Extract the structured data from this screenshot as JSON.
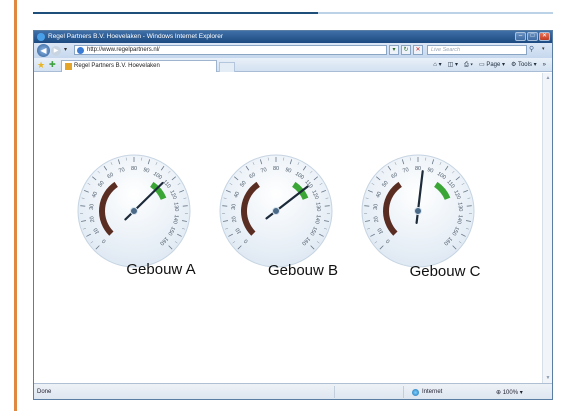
{
  "window": {
    "title": "Regel Partners B.V. Hoevelaken - Windows Internet Explorer",
    "minimize_glyph": "–",
    "maximize_glyph": "□",
    "close_glyph": "✕"
  },
  "address": {
    "url": "http://www.regelpartners.nl/",
    "search_placeholder": "Live Search"
  },
  "tab": {
    "label": "Regel Partners B.V. Hoevelaken"
  },
  "toolbar": {
    "page_label": "Page",
    "tools_label": "Tools"
  },
  "status": {
    "left": "Done",
    "zone": "Internet",
    "zoom": "100%"
  },
  "colors": {
    "arc_brown": "#5a2d22",
    "arc_green": "#3aa635",
    "needle": "#1c2a3a",
    "face": "#dfe9f3"
  },
  "gauges": [
    {
      "label": "Gebouw A",
      "scale": [
        0,
        10,
        20,
        30,
        40,
        50,
        60,
        70,
        80,
        90,
        100,
        110,
        120,
        130,
        140,
        150,
        160
      ],
      "value": 107
    },
    {
      "label": "Gebouw B",
      "scale": [
        0,
        10,
        20,
        30,
        40,
        50,
        60,
        70,
        80,
        90,
        100,
        110,
        120,
        130,
        140,
        150,
        160
      ],
      "value": 111
    },
    {
      "label": "Gebouw C",
      "scale": [
        0,
        10,
        20,
        30,
        40,
        50,
        60,
        70,
        80,
        90,
        100,
        110,
        120,
        130,
        140,
        150,
        160
      ],
      "value": 84
    }
  ]
}
